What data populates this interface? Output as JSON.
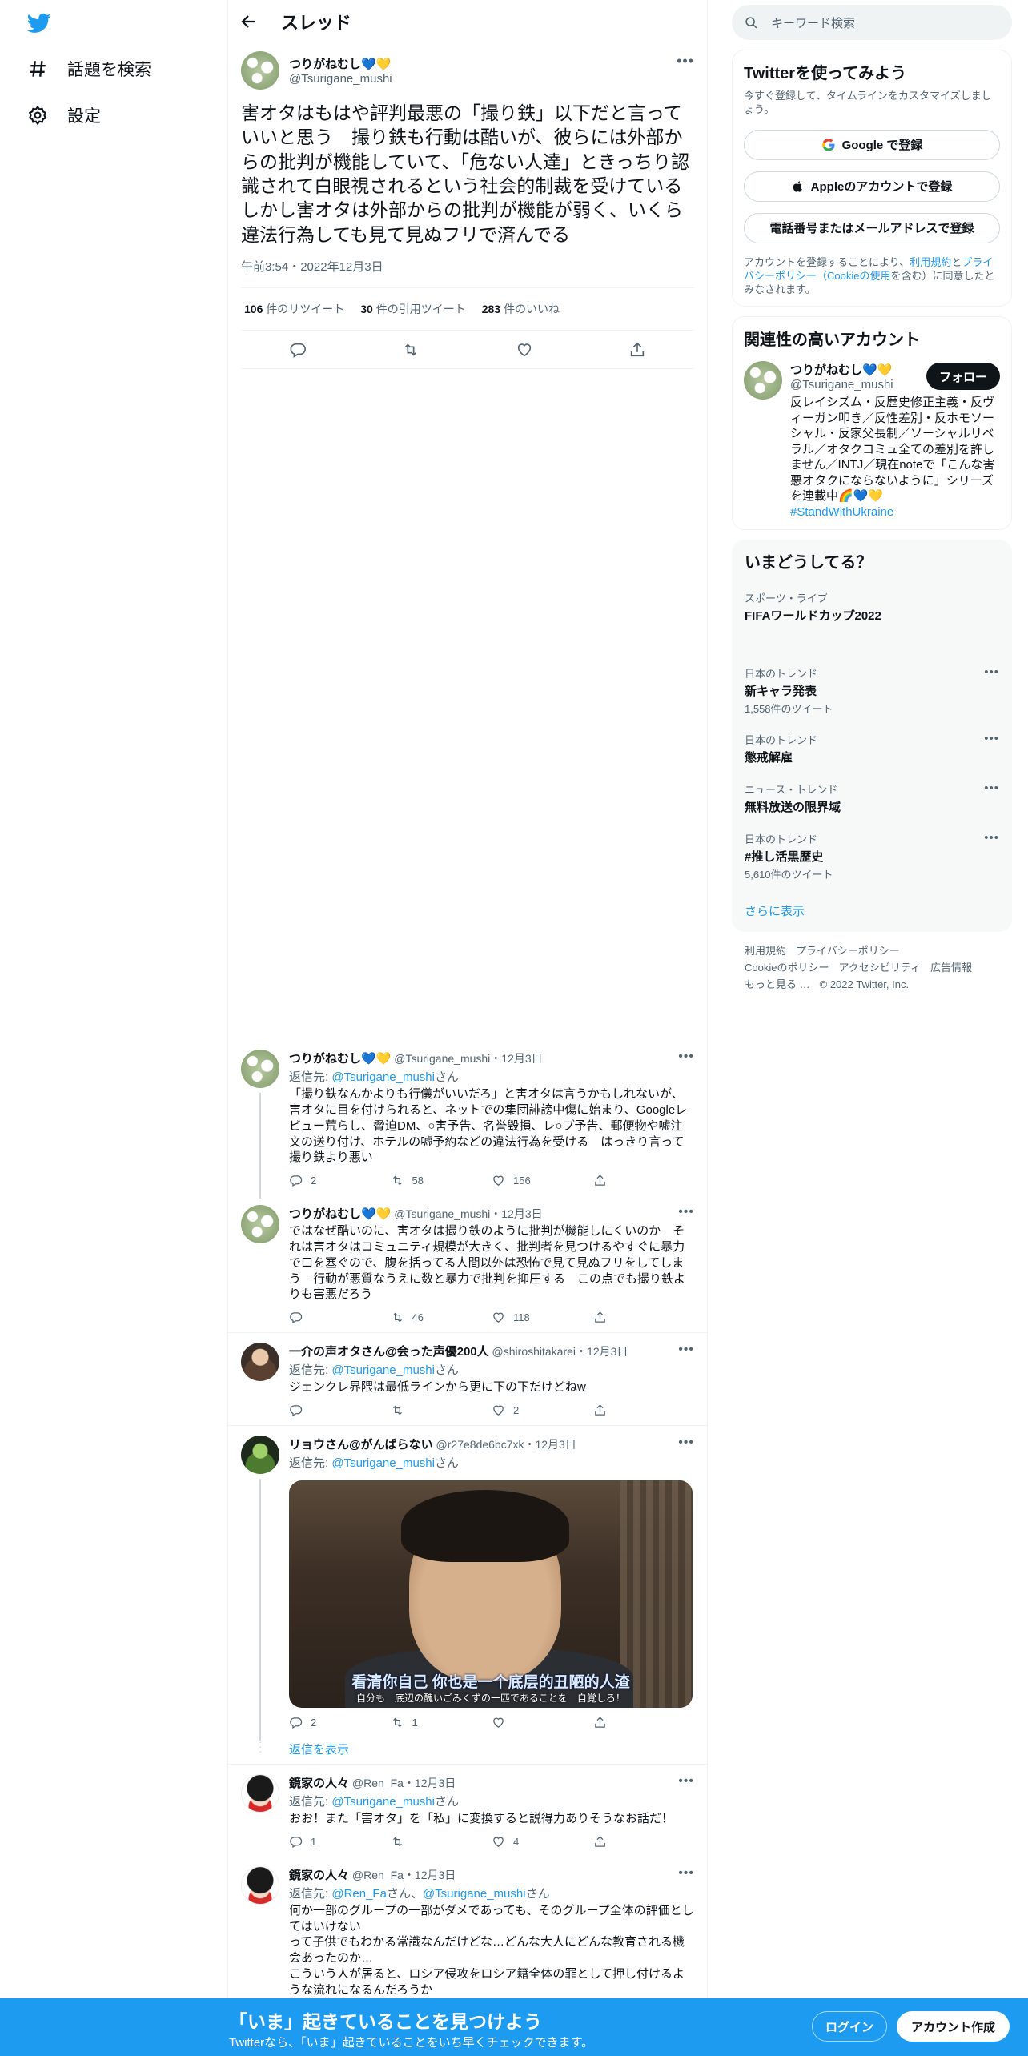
{
  "colors": {
    "accent": "#1d9bf0",
    "text": "#0f1419",
    "secondary": "#536471",
    "bottom_bar": "#1d9bf0"
  },
  "nav": {
    "logo_icon": "twitter-bird-icon",
    "explore_label": "話題を検索",
    "settings_label": "設定"
  },
  "header": {
    "title": "スレッド"
  },
  "focus_tweet": {
    "name": "つりがねむし💙💛",
    "handle": "@Tsurigane_mushi",
    "text": "害オタはもはや評判最悪の「撮り鉄」以下だと言っていいと思う　撮り鉄も行動は酷いが、彼らには外部からの批判が機能していて、「危ない人達」ときっちり認識されて白眼視されるという社会的制裁を受けている　しかし害オタは外部からの批判が機能が弱く、いくら違法行為しても見て見ぬフリで済んでる",
    "timestamp": "午前3:54・2022年12月3日",
    "retweets": "106",
    "retweets_label": " 件のリツイート",
    "quotes": "30",
    "quotes_label": " 件の引用ツイート",
    "likes": "283",
    "likes_label": " 件のいいね"
  },
  "replies": [
    {
      "name": "つりがねむし💙💛",
      "handle": "@Tsurigane_mushi",
      "date": "・12月3日",
      "replying_prefix": "返信先: ",
      "replying_to": "@Tsurigane_mushi",
      "replying_suffix": "さん",
      "text": "「撮り鉄なんかよりも行儀がいいだろ」と害オタは言うかもしれないが、害オタに目を付けられると、ネットでの集団誹謗中傷に始まり、Googleレビュー荒らし、脅迫DM、○害予告、名誉毀損、レ○プ予告、郵便物や嘘注文の送り付け、ホテルの嘘予約などの違法行為を受ける　はっきり言って撮り鉄より悪い",
      "reply_count": "2",
      "retweet_count": "58",
      "like_count": "156"
    },
    {
      "name": "つりがねむし💙💛",
      "handle": "@Tsurigane_mushi",
      "date": "・12月3日",
      "text": "ではなぜ酷いのに、害オタは撮り鉄のように批判が機能しにくいのか　それは害オタはコミュニティ規模が大きく、批判者を見つけるやすぐに暴力で口を塞ぐので、腹を括ってる人間以外は恐怖で見て見ぬフリをしてしまう　行動が悪質なうえに数と暴力で批判を抑圧する　この点でも撮り鉄よりも害悪だろう",
      "reply_count": "",
      "retweet_count": "46",
      "like_count": "118"
    },
    {
      "name": "一介の声オタさん@会った声優200人",
      "handle": "@shiroshitakarei",
      "date": "・12月3日",
      "replying_prefix": "返信先: ",
      "replying_to": "@Tsurigane_mushi",
      "replying_suffix": "さん",
      "text": "ジェンクレ界隈は最低ラインから更に下の下だけどねw",
      "reply_count": "",
      "retweet_count": "",
      "like_count": "2"
    },
    {
      "name": "リョウさん@がんばらない",
      "handle": "@r27e8de6bc7xk",
      "date": "・12月3日",
      "replying_prefix": "返信先: ",
      "replying_to": "@Tsurigane_mushi",
      "replying_suffix": "さん",
      "media_sub_cn": "看清你自己 你也是一个底层的丑陋的人渣",
      "media_sub_jp": "自分も　底辺の醜いごみくずの一匹であることを　自覚しろ！",
      "reply_count": "2",
      "retweet_count": "1",
      "like_count": ""
    },
    {
      "name": "鏡家の人々",
      "handle": "@Ren_Fa",
      "date": "・12月3日",
      "replying_prefix": "返信先: ",
      "replying_to": "@Tsurigane_mushi",
      "replying_suffix": "さん",
      "text": "おお！また「害オタ」を「私」に変換すると説得力ありそうなお話だ！",
      "reply_count": "1",
      "retweet_count": "",
      "like_count": "4"
    },
    {
      "name": "鏡家の人々",
      "handle": "@Ren_Fa",
      "date": "・12月3日",
      "replying_prefix": "返信先: ",
      "replying_to_1": "@Ren_Fa",
      "replying_mid": "さん、",
      "replying_to_2": "@Tsurigane_mushi",
      "replying_suffix": "さん",
      "text": "何か一部のグループの一部がダメであっても、そのグループ全体の評価としてはいけない\nって子供でもわかる常識なんだけどな…どんな大人にどんな教育される機会あったのか…\nこういう人が居ると、ロシア侵攻をロシア籍全体の罪として押し付けるような流れになるんだろうか"
    }
  ],
  "show_replies_label": "返信を表示",
  "sidebar": {
    "search_placeholder": "キーワード検索",
    "signup": {
      "title": "Twitterを使ってみよう",
      "subtitle": "今すぐ登録して、タイムラインをカスタマイズしましょう。",
      "google_label": "Google で登録",
      "apple_label": "Appleのアカウントで登録",
      "phone_label": "電話番号またはメールアドレスで登録",
      "legal_prefix": "アカウントを登録することにより、",
      "terms_link": "利用規約",
      "legal_and": "と",
      "privacy_link": "プライバシーポリシー（Cookieの使用",
      "legal_suffix": "を含む）に同意したとみなされます。"
    },
    "related": {
      "title": "関連性の高いアカウント",
      "name": "つりがねむし💙💛",
      "handle": "@Tsurigane_mushi",
      "follow_label": "フォロー",
      "bio": "反レイシズム・反歴史修正主義・反ヴィーガン叩き／反性差別・反ホモソーシャル・反家父長制／ソーシャルリベラル／オタクコミュ全ての差別を許しません／INTJ／現在noteで「こんな害悪オタクにならないように」シリーズを連載中🌈💙💛",
      "hashtag": "#StandWithUkraine"
    },
    "trends": {
      "title": "いまどうしてる？",
      "items": [
        {
          "category": "スポーツ・ライブ",
          "name": "FIFAワールドカップ2022",
          "count": ""
        },
        {
          "category": "日本のトレンド",
          "name": "新キャラ発表",
          "count": "1,558件のツイート"
        },
        {
          "category": "日本のトレンド",
          "name": "懲戒解雇",
          "count": ""
        },
        {
          "category": "ニュース・トレンド",
          "name": "無料放送の限界域",
          "count": ""
        },
        {
          "category": "日本のトレンド",
          "name": "#推し活黒歴史",
          "count": "5,610件のツイート"
        }
      ],
      "show_more": "さらに表示"
    },
    "footer": {
      "terms": "利用規約",
      "privacy": "プライバシーポリシー",
      "cookie": "Cookieのポリシー",
      "accessibility": "アクセシビリティ",
      "ads": "広告情報",
      "more": "もっと見る …",
      "copyright": "© 2022 Twitter, Inc."
    }
  },
  "bottom_bar": {
    "title": "「いま」起きていることを見つけよう",
    "subtitle": "Twitterなら、「いま」起きていることをいち早くチェックできます。",
    "login": "ログイン",
    "signup": "アカウント作成"
  }
}
